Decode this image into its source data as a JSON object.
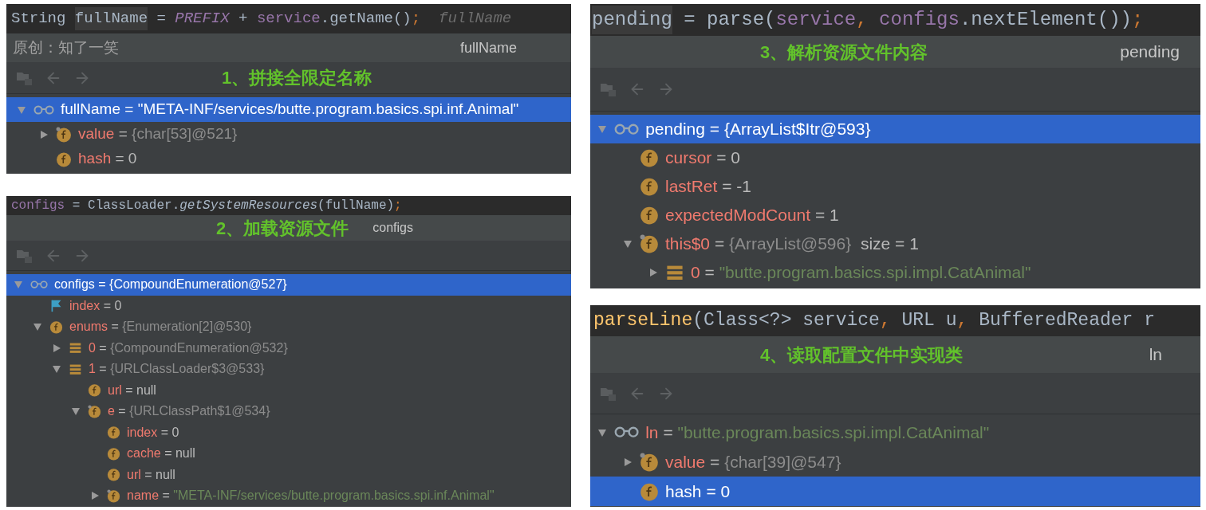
{
  "panels": [
    {
      "code": [
        {
          "text": "String ",
          "kind": "plain"
        },
        {
          "text": "fullName",
          "kind": "highlight"
        },
        {
          "text": " = ",
          "kind": "plain"
        },
        {
          "text": "PREFIX",
          "kind": "constant"
        },
        {
          "text": " + ",
          "kind": "plain"
        },
        {
          "text": "service",
          "kind": "var"
        },
        {
          "text": ".getName()",
          "kind": "plain"
        },
        {
          "text": ";",
          "kind": "punct"
        },
        {
          "text": "  fullName",
          "kind": "hint"
        }
      ],
      "note": "原创：知了一笑",
      "step": "1、拼接全限定名称",
      "watch": "fullName",
      "tree": [
        {
          "kind": "watch",
          "name": "fullName",
          "sep": "=",
          "value": {
            "text": "\"META-INF/services/butte.program.basics.spi.inf.Animal\"",
            "kind": "string"
          },
          "expanded": true,
          "selected": true,
          "children": [
            {
              "kind": "field",
              "overlay": true,
              "name": "value",
              "sep": "=",
              "value": {
                "text": "{char[53]@521}",
                "kind": "ref"
              },
              "expanded": false,
              "selected": false
            },
            {
              "kind": "field",
              "name": "hash",
              "sep": "=",
              "value": {
                "text": "0",
                "kind": "literal"
              },
              "selected": false
            }
          ]
        }
      ]
    },
    {
      "code": [
        {
          "text": "configs",
          "kind": "var"
        },
        {
          "text": " = ClassLoader.",
          "kind": "plain"
        },
        {
          "text": "getSystemResources",
          "kind": "call"
        },
        {
          "text": "(fullName)",
          "kind": "plain"
        },
        {
          "text": ";",
          "kind": "punct"
        }
      ],
      "step": "2、加载资源文件",
      "watch": "configs",
      "tree": [
        {
          "kind": "watch",
          "name": "configs",
          "sep": "=",
          "value": {
            "text": "{CompoundEnumeration@527}",
            "kind": "ref"
          },
          "expanded": true,
          "selected": true,
          "children": [
            {
              "kind": "flag",
              "name": "index",
              "sep": "=",
              "value": {
                "text": "0",
                "kind": "literal"
              },
              "selected": false
            },
            {
              "kind": "field",
              "name": "enums",
              "sep": "=",
              "value": {
                "text": "{Enumeration[2]@530}",
                "kind": "ref"
              },
              "expanded": true,
              "selected": false,
              "children": [
                {
                  "kind": "array",
                  "name": "0",
                  "sep": "=",
                  "value": {
                    "text": "{CompoundEnumeration@532}",
                    "kind": "ref"
                  },
                  "expanded": false,
                  "selected": false
                },
                {
                  "kind": "array",
                  "name": "1",
                  "sep": "=",
                  "value": {
                    "text": "{URLClassLoader$3@533}",
                    "kind": "ref"
                  },
                  "expanded": true,
                  "selected": false,
                  "children": [
                    {
                      "kind": "field",
                      "name": "url",
                      "sep": "=",
                      "value": {
                        "text": "null",
                        "kind": "literal"
                      },
                      "selected": false
                    },
                    {
                      "kind": "field",
                      "overlay": true,
                      "name": "e",
                      "sep": "=",
                      "value": {
                        "text": "{URLClassPath$1@534}",
                        "kind": "ref"
                      },
                      "expanded": true,
                      "selected": false,
                      "children": [
                        {
                          "kind": "field",
                          "name": "index",
                          "sep": "=",
                          "value": {
                            "text": "0",
                            "kind": "literal"
                          },
                          "selected": false
                        },
                        {
                          "kind": "field",
                          "name": "cache",
                          "sep": "=",
                          "value": {
                            "text": "null",
                            "kind": "literal"
                          },
                          "selected": false
                        },
                        {
                          "kind": "field",
                          "name": "url",
                          "sep": "=",
                          "value": {
                            "text": "null",
                            "kind": "literal"
                          },
                          "selected": false
                        },
                        {
                          "kind": "field",
                          "overlay": true,
                          "name": "name",
                          "sep": "=",
                          "value": {
                            "text": "\"META-INF/services/butte.program.basics.spi.inf.Animal\"",
                            "kind": "string"
                          },
                          "expanded": false,
                          "selected": false
                        }
                      ]
                    }
                  ]
                }
              ]
            }
          ]
        }
      ]
    },
    {
      "code": [
        {
          "text": "pending",
          "kind": "highlight"
        },
        {
          "text": " = parse(",
          "kind": "plain"
        },
        {
          "text": "service",
          "kind": "var"
        },
        {
          "text": ",",
          "kind": "punct"
        },
        {
          "text": " configs",
          "kind": "var"
        },
        {
          "text": ".nextElement())",
          "kind": "plain"
        },
        {
          "text": ";",
          "kind": "punct"
        }
      ],
      "step": "3、解析资源文件内容",
      "watch": "pending",
      "tree": [
        {
          "kind": "watch",
          "name": "pending",
          "sep": "=",
          "value": {
            "text": "{ArrayList$Itr@593}",
            "kind": "ref"
          },
          "expanded": true,
          "selected": true,
          "children": [
            {
              "kind": "field",
              "name": "cursor",
              "sep": "=",
              "value": {
                "text": "0",
                "kind": "literal"
              },
              "selected": false
            },
            {
              "kind": "field",
              "name": "lastRet",
              "sep": "=",
              "value": {
                "text": "-1",
                "kind": "literal"
              },
              "selected": false
            },
            {
              "kind": "field",
              "name": "expectedModCount",
              "sep": "=",
              "value": {
                "text": "1",
                "kind": "literal"
              },
              "selected": false
            },
            {
              "kind": "field",
              "overlay": true,
              "name": "this$0",
              "sep": "=",
              "value": {
                "text": "{ArrayList@596}",
                "kind": "ref"
              },
              "extra": "size = 1",
              "expanded": true,
              "selected": false,
              "children": [
                {
                  "kind": "array",
                  "name": "0",
                  "sep": "=",
                  "value": {
                    "text": "\"butte.program.basics.spi.impl.CatAnimal\"",
                    "kind": "string"
                  },
                  "expanded": false,
                  "selected": false
                }
              ]
            }
          ]
        }
      ]
    },
    {
      "code": [
        {
          "text": "parseLine",
          "kind": "method"
        },
        {
          "text": "(Class<?> service",
          "kind": "plain"
        },
        {
          "text": ",",
          "kind": "punct"
        },
        {
          "text": " URL u",
          "kind": "plain"
        },
        {
          "text": ",",
          "kind": "punct"
        },
        {
          "text": " BufferedReader r",
          "kind": "plain"
        }
      ],
      "step": "4、读取配置文件中实现类",
      "watch": "ln",
      "tree": [
        {
          "kind": "watch",
          "name": "ln",
          "sep": "=",
          "value": {
            "text": "\"butte.program.basics.spi.impl.CatAnimal\"",
            "kind": "string"
          },
          "expanded": true,
          "selected": false,
          "children": [
            {
              "kind": "field",
              "overlay": true,
              "name": "value",
              "sep": "=",
              "value": {
                "text": "{char[39]@547}",
                "kind": "ref"
              },
              "expanded": false,
              "selected": false
            },
            {
              "kind": "field",
              "name": "hash",
              "sep": "=",
              "value": {
                "text": "0",
                "kind": "literal"
              },
              "selected": true
            }
          ]
        }
      ]
    }
  ]
}
